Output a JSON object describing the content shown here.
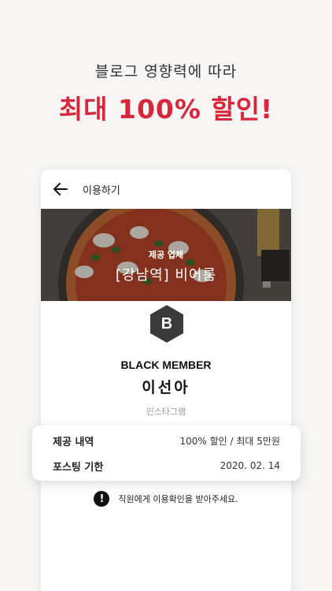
{
  "promo": {
    "subtitle": "블로그 영향력에 따라",
    "headline": "최대 100% 할인!"
  },
  "colors": {
    "accent": "#d8263a",
    "background": "#f7f6f4",
    "badge": "#3a3a3a"
  },
  "screen": {
    "back_icon": "arrow-left-icon",
    "title": "이용하기",
    "hero": {
      "label": "제공 업체",
      "store_name": "[강남역] 비어룸"
    },
    "badge_letter": "B",
    "tier": "BLACK MEMBER",
    "member_name": "이선아",
    "platform": "인스타그램"
  },
  "details": {
    "benefit_label": "제공 내역",
    "benefit_value": "100% 할인 / 최대 5만원",
    "deadline_label": "포스팅 기한",
    "deadline_value": "2020. 02. 14"
  },
  "notice": {
    "icon": "exclamation-icon",
    "text": "직원에게 이용확인을 받아주세요."
  }
}
